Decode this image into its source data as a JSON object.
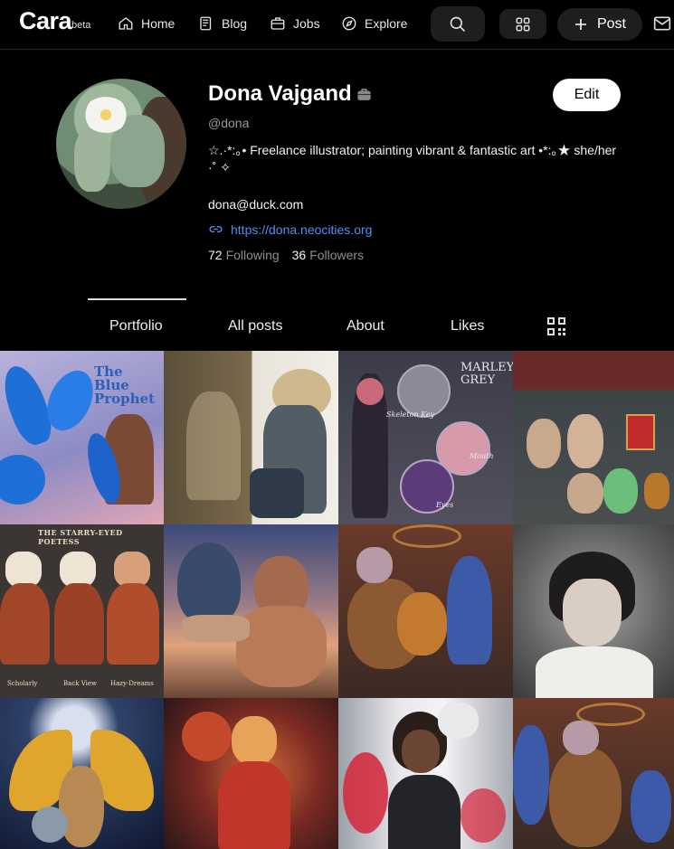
{
  "app": {
    "logo": "Cara",
    "logo_badge": "beta"
  },
  "nav": {
    "items": [
      {
        "label": "Home",
        "icon": "home-icon"
      },
      {
        "label": "Blog",
        "icon": "blog-icon"
      },
      {
        "label": "Jobs",
        "icon": "briefcase-icon"
      },
      {
        "label": "Explore",
        "icon": "compass-icon"
      }
    ],
    "post_label": "Post"
  },
  "profile": {
    "name": "Dona Vajgand",
    "username": "@dona",
    "bio": "☆.·*:｡• Freelance illustrator; painting vibrant & fantastic art •*:｡★ she/her ·˚ ✧",
    "email": "dona@duck.com",
    "website": "https://dona.neocities.org",
    "following_count": "72",
    "following_label": "Following",
    "followers_count": "36",
    "followers_label": "Followers",
    "edit_label": "Edit"
  },
  "tabs": [
    {
      "label": "Portfolio",
      "active": true
    },
    {
      "label": "All posts",
      "active": false
    },
    {
      "label": "About",
      "active": false
    },
    {
      "label": "Likes",
      "active": false
    }
  ],
  "portfolio_captions": {
    "blue_prophet": "The Blue Prophet",
    "marley_grey": "MARLEY GREY",
    "skeleton_key": "Skeleton Key",
    "mouth": "Mouth",
    "eyes": "Eyes",
    "poetess": "THE STARRY-EYED POETESS",
    "scholarly": "Scholarly",
    "back_view": "Back View",
    "hazy_dreams": "Hazy-Dreams"
  },
  "colors": {
    "accent_link": "#4f8ff7",
    "background": "#000000"
  }
}
